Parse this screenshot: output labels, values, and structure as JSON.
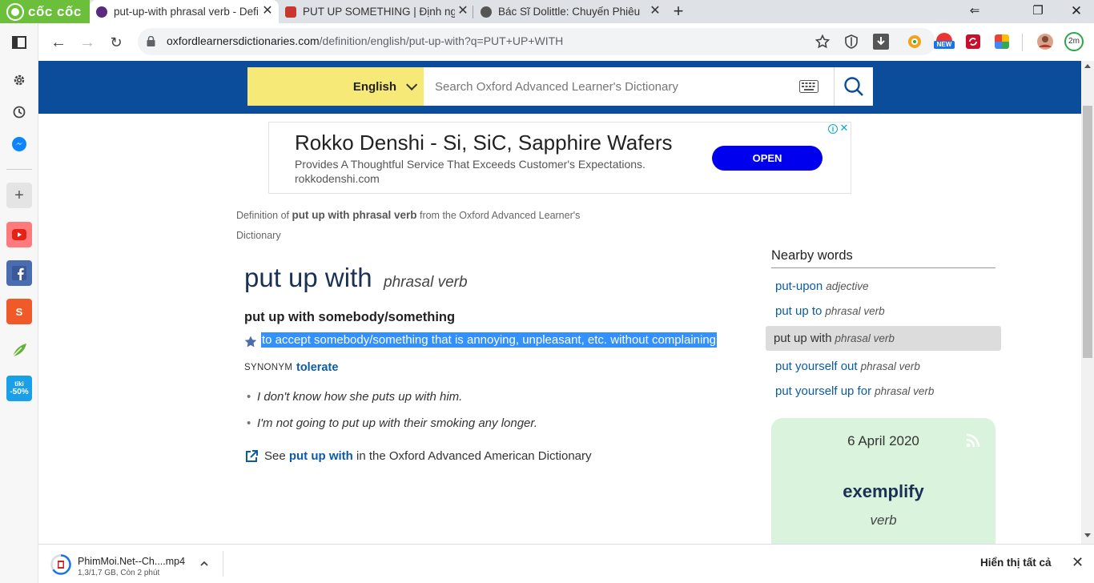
{
  "browser": {
    "brand": "cốc cốc",
    "tabs": [
      {
        "title": "put-up-with phrasal verb - Defi",
        "active": true
      },
      {
        "title": "PUT UP SOMETHING | Định ngh",
        "active": false
      },
      {
        "title": "Bác Sĩ Dolittle: Chuyến Phiêu L",
        "active": false
      }
    ],
    "url_host": "oxfordlearnersdictionaries.com",
    "url_path": "/definition/english/put-up-with?q=PUT+UP+WITH",
    "ext_badges": {
      "new": "NEW",
      "timer": "2m"
    }
  },
  "header": {
    "language": "English",
    "search_placeholder": "Search Oxford Advanced Learner's Dictionary"
  },
  "ad": {
    "title": "Rokko Denshi - Si, SiC, Sapphire Wafers",
    "description": "Provides A Thoughtful Service That Exceeds Customer's Expectations.",
    "domain": "rokkodenshi.com",
    "cta": "OPEN"
  },
  "entry": {
    "source_prefix": "Definition of ",
    "source_term": "put up with phrasal verb",
    "source_suffix": " from the Oxford Advanced Learner's Dictionary",
    "headword": "put up with",
    "pos": "phrasal verb",
    "sense_head": "put up with somebody/something",
    "definition": "to accept somebody/something that is annoying, unpleasant, etc. without complaining",
    "synonym_label": "SYNONYM",
    "synonym": "tolerate",
    "examples": [
      "I don't know how she puts up with him.",
      "I'm not going to put up with their smoking any longer."
    ],
    "see_prefix": "See ",
    "see_link": "put up with",
    "see_suffix": " in the Oxford Advanced American Dictionary"
  },
  "nearby": {
    "title": "Nearby words",
    "items": [
      {
        "word": "put-upon",
        "pos": "adjective",
        "current": false
      },
      {
        "word": "put up to",
        "pos": "phrasal verb",
        "current": false
      },
      {
        "word": "put up with",
        "pos": "phrasal verb",
        "current": true
      },
      {
        "word": "put yourself out",
        "pos": "phrasal verb",
        "current": false
      },
      {
        "word": "put yourself up for",
        "pos": "phrasal verb",
        "current": false
      }
    ]
  },
  "word_of_the_day": {
    "date": "6 April 2020",
    "word": "exemplify",
    "pos": "verb"
  },
  "download": {
    "filename": "PhimMoi.Net--Ch....mp4",
    "status": "1,3/1,7 GB, Còn 2 phút",
    "show_all": "Hiển thị tất cả"
  },
  "colors": {
    "header_blue": "#0b4d9a",
    "lang_yellow": "#f6e977",
    "link_blue": "#0b5ca5",
    "selection": "#3390ff",
    "wotd_bg": "#d9f3dd",
    "brand_green": "#6bbf3b"
  }
}
